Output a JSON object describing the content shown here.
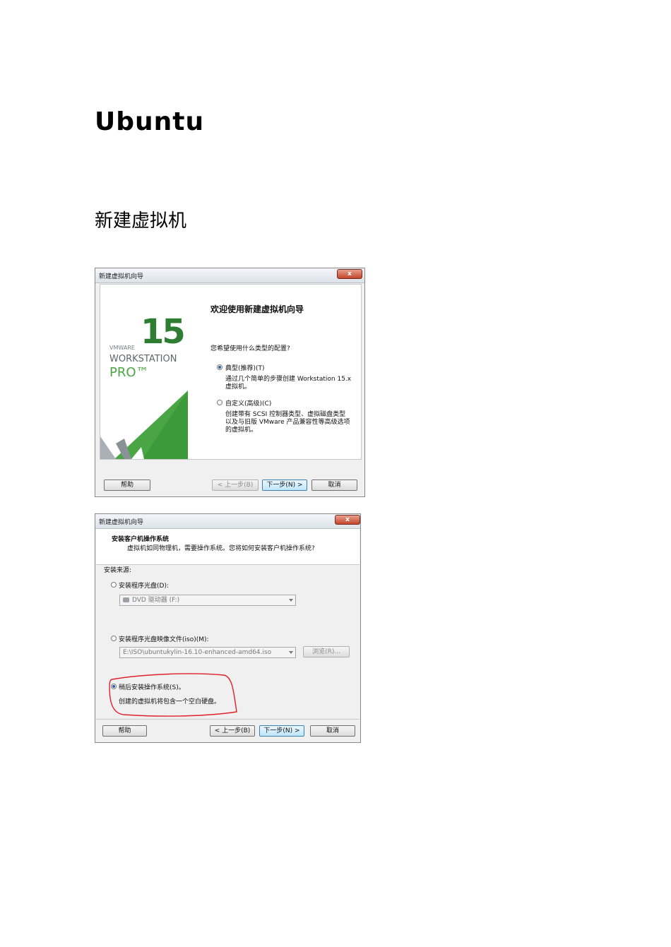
{
  "document": {
    "title": "Ubuntu",
    "section": "新建虚拟机"
  },
  "wizard1": {
    "window_title": "新建虚拟机向导",
    "close": "x",
    "brand": {
      "version": "15",
      "vmware": "VMWARE",
      "workstation": "WORKSTATION",
      "pro": "PRO™",
      "green": "#4aa544",
      "dark_green": "#2e7d32"
    },
    "heading": "欢迎使用新建虚拟机向导",
    "question": "您希望使用什么类型的配置?",
    "option_typical": {
      "label": "典型(推荐)(T)",
      "desc1": "通过几个简单的步骤创建 Workstation 15.x",
      "desc2": "虚拟机。",
      "checked": true
    },
    "option_custom": {
      "label": "自定义(高级)(C)",
      "desc1": "创建带有 SCSI 控制器类型、虚拟磁盘类型",
      "desc2": "以及与旧版 VMware 产品兼容性等高级选项",
      "desc3": "的虚拟机。",
      "checked": false
    },
    "buttons": {
      "help": "帮助",
      "back": "< 上一步(B)",
      "next": "下一步(N) >",
      "cancel": "取消"
    }
  },
  "wizard2": {
    "window_title": "新建虚拟机向导",
    "close": "x",
    "heading": "安装客户机操作系统",
    "subheading": "虚拟机如同物理机，需要操作系统。您将如何安装客户机操作系统?",
    "source_label": "安装来源:",
    "option_disc": {
      "label": "安装程序光盘(D):",
      "checked": false,
      "drive": "DVD 驱动器 (F:)"
    },
    "option_iso": {
      "label": "安装程序光盘映像文件(iso)(M):",
      "checked": false,
      "path": "E:\\ISO\\ubuntukylin-16.10-enhanced-amd64.iso",
      "browse": "浏览(R)..."
    },
    "option_later": {
      "label": "稍后安装操作系统(S)。",
      "desc": "创建的虚拟机将包含一个空白硬盘。",
      "checked": true
    },
    "annotation_color": "#e0202a",
    "buttons": {
      "help": "帮助",
      "back": "< 上一步(B)",
      "next": "下一步(N) >",
      "cancel": "取消"
    }
  }
}
